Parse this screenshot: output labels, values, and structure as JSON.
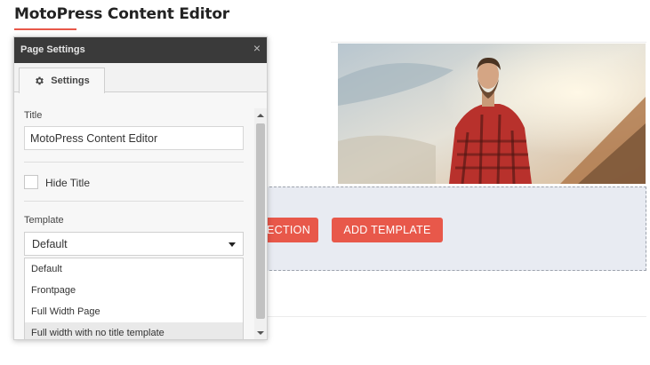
{
  "page": {
    "title": "MotoPress Content Editor",
    "accent_color": "#e8584a"
  },
  "editor": {
    "section_button_label": "ECTION",
    "add_template_label": "ADD TEMPLATE",
    "section_bg_color": "#e8ebf2"
  },
  "dialog": {
    "title": "Page Settings",
    "close_icon": "close-icon",
    "tab_label": "Settings",
    "tab_icon": "gear-icon",
    "title_label": "Title",
    "title_value": "MotoPress Content Editor",
    "hide_title_label": "Hide Title",
    "hide_title_checked": false,
    "template_label": "Template",
    "template_selected": "Default",
    "template_options": [
      "Default",
      "Frontpage",
      "Full Width Page",
      "Full width with no title template"
    ],
    "highlighted_option": 3
  }
}
